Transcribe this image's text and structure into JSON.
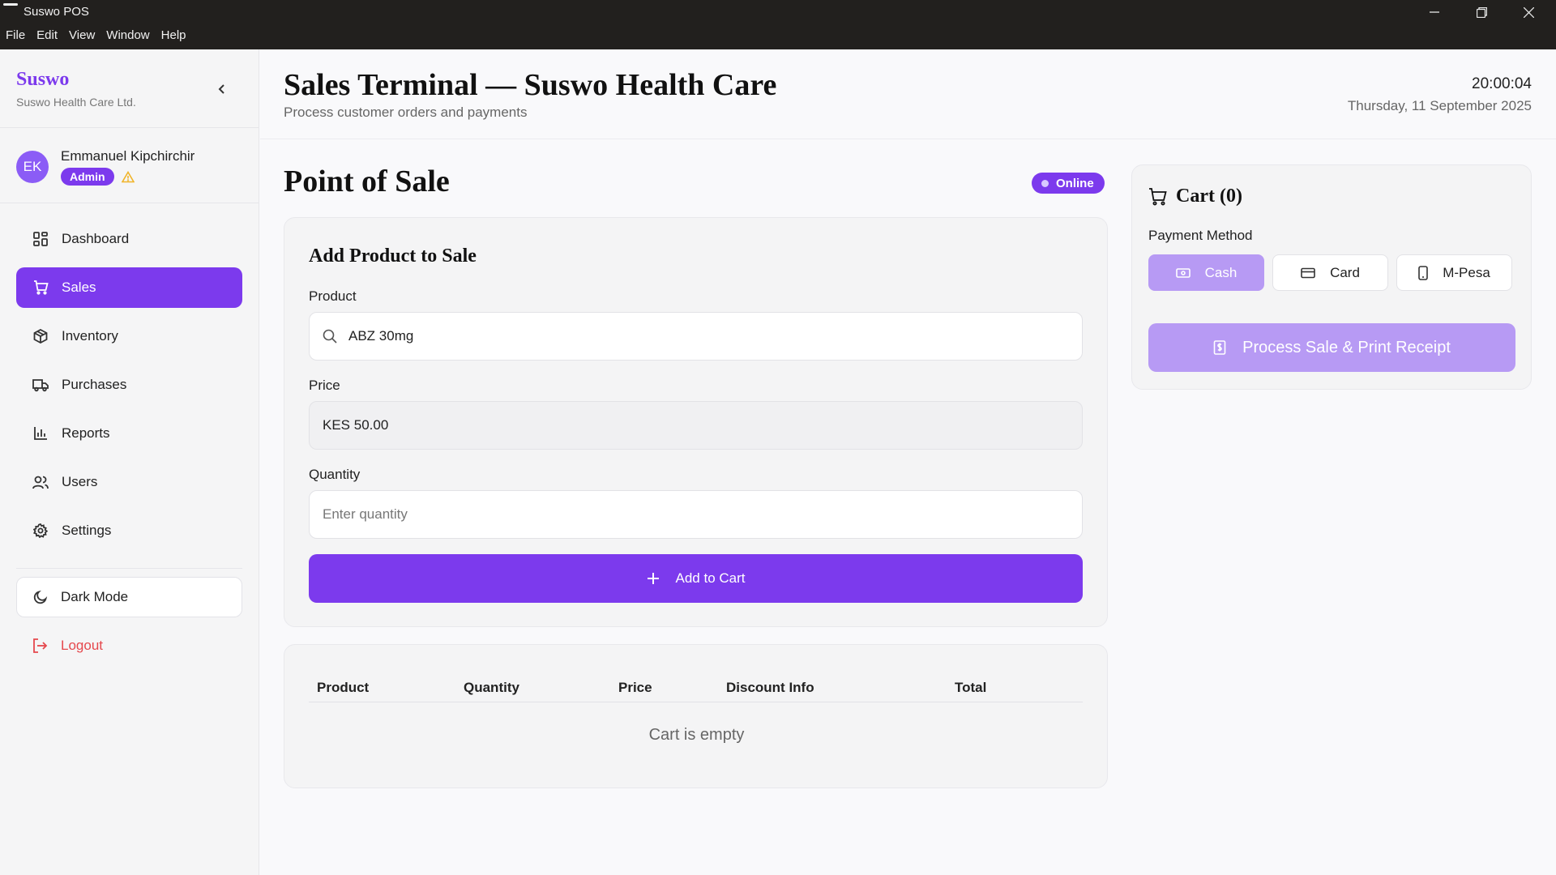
{
  "window": {
    "title": "Suswo POS",
    "menu": [
      "File",
      "Edit",
      "View",
      "Window",
      "Help"
    ]
  },
  "sidebar": {
    "brand": "Suswo",
    "company": "Suswo Health Care Ltd.",
    "user": {
      "initials": "EK",
      "name": "Emmanuel Kipchirchir",
      "role": "Admin"
    },
    "nav": [
      {
        "label": "Dashboard",
        "icon": "grid-icon"
      },
      {
        "label": "Sales",
        "icon": "cart-icon"
      },
      {
        "label": "Inventory",
        "icon": "box-icon"
      },
      {
        "label": "Purchases",
        "icon": "truck-icon"
      },
      {
        "label": "Reports",
        "icon": "bar-chart-icon"
      },
      {
        "label": "Users",
        "icon": "users-icon"
      },
      {
        "label": "Settings",
        "icon": "gear-icon"
      }
    ],
    "dark_mode": "Dark Mode",
    "logout": "Logout"
  },
  "header": {
    "title": "Sales Terminal — Suswo Health Care",
    "subtitle": "Process customer orders and payments",
    "time": "20:00:04",
    "date": "Thursday, 11 September 2025"
  },
  "pos": {
    "title": "Point of Sale",
    "status": "Online",
    "form": {
      "title": "Add Product to Sale",
      "product_label": "Product",
      "product_value": "ABZ 30mg",
      "price_label": "Price",
      "price_value": "KES 50.00",
      "quantity_label": "Quantity",
      "quantity_placeholder": "Enter quantity",
      "add_button": "Add to Cart"
    },
    "table": {
      "columns": [
        "Product",
        "Quantity",
        "Price",
        "Discount Info",
        "Total"
      ],
      "empty": "Cart is empty"
    }
  },
  "cart": {
    "title": "Cart (0)",
    "payment_label": "Payment Method",
    "methods": [
      "Cash",
      "Card",
      "M-Pesa"
    ],
    "selected_method": "Cash",
    "process_button": "Process Sale & Print Receipt"
  },
  "colors": {
    "accent": "#7c3aed",
    "accent_light": "#b79af4",
    "danger": "#e5484d",
    "warning": "#f0b429"
  }
}
